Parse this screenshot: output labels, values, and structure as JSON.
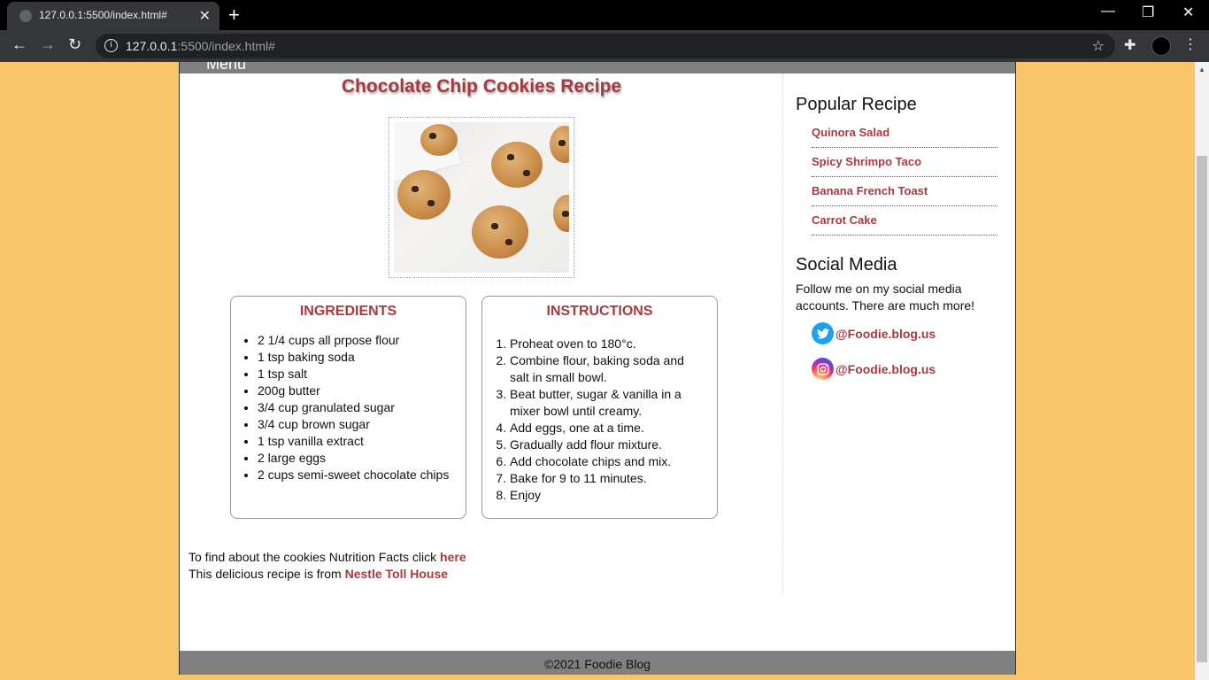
{
  "browser": {
    "tab_title": "127.0.0.1:5500/index.html#",
    "url_host": "127.0.0.1",
    "url_rest": ":5500/index.html#"
  },
  "page": {
    "menu_label": "Menu",
    "title": "Chocolate Chip Cookies Recipe",
    "ingredients": {
      "heading": "INGREDIENTS",
      "items": [
        "2 1/4 cups all prpose flour",
        "1 tsp baking soda",
        "1 tsp salt",
        "200g butter",
        "3/4 cup granulated sugar",
        "3/4 cup brown sugar",
        "1 tsp vanilla extract",
        "2 large eggs",
        "2 cups semi-sweet chocolate chips"
      ]
    },
    "instructions": {
      "heading": "INSTRUCTIONS",
      "steps": [
        "Proheat oven to 180°c.",
        "Combine flour, baking soda and salt in small bowl.",
        "Beat butter, sugar & vanilla in a mixer bowl until creamy.",
        "Add eggs, one at a time.",
        "Gradually add flour mixture.",
        "Add chocolate chips and mix.",
        "Bake for 9 to 11 minutes.",
        "Enjoy"
      ]
    },
    "nutrition_text": "To find about the cookies Nutrition Facts click ",
    "nutrition_link": "here",
    "source_text": "This delicious recipe is from ",
    "source_link": "Nestle Toll House",
    "footer": "©2021 Foodie Blog"
  },
  "sidebar": {
    "popular_title": "Popular Recipe",
    "recipes": [
      "Quinora Salad",
      "Spicy Shrimpo Taco",
      "Banana French Toast",
      "Carrot Cake"
    ],
    "social_title": "Social Media",
    "social_text": "Follow me on my social media accounts. There are much more!",
    "twitter_handle": "@Foodie.blog.us",
    "instagram_handle": "@Foodie.blog.us"
  }
}
